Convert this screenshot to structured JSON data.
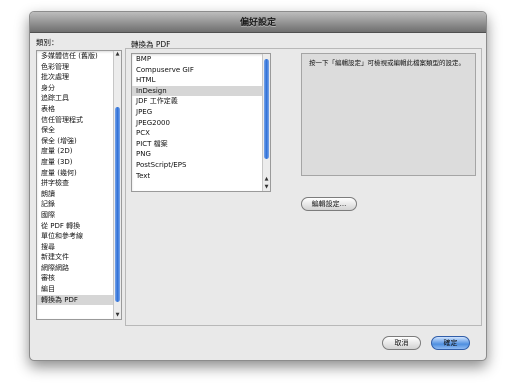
{
  "window": {
    "title": "偏好設定"
  },
  "categories": {
    "label": "類別：",
    "items": [
      "多媒體信任 (舊版)",
      "色彩管理",
      "批次處理",
      "身分",
      "追踪工具",
      "表格",
      "信任管理程式",
      "保全",
      "保全 (增強)",
      "度量 (2D)",
      "度量 (3D)",
      "度量 (幾何)",
      "拼字檢查",
      "朗讀",
      "記錄",
      "國際",
      "從 PDF 轉換",
      "單位和參考線",
      "搜尋",
      "新建文件",
      "網際網路",
      "審核",
      "編目",
      "轉換為 PDF"
    ],
    "selected_index": 23
  },
  "convert": {
    "label": "轉換為 PDF",
    "items": [
      "BMP",
      "Compuserve GIF",
      "HTML",
      "InDesign",
      "JDF 工作定義",
      "JPEG",
      "JPEG2000",
      "PCX",
      "PICT 檔案",
      "PNG",
      "PostScript/EPS",
      "Text"
    ],
    "selected_index": 3
  },
  "description": "按一下「編輯設定」可檢視或編輯此檔案類型的設定。",
  "buttons": {
    "edit_settings": "編輯設定...",
    "cancel": "取消",
    "ok": "確定"
  }
}
